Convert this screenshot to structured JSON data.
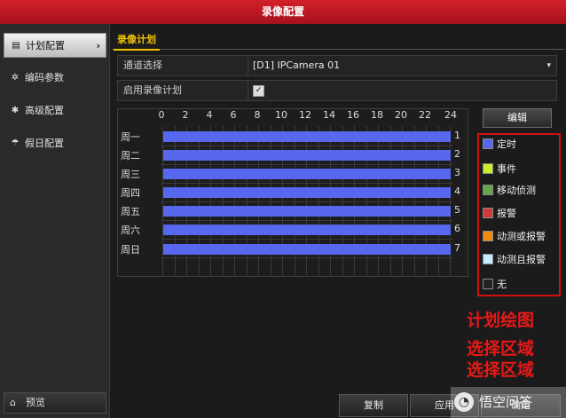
{
  "window": {
    "title": "录像配置"
  },
  "sidebar": {
    "items": [
      {
        "label": "计划配置",
        "icon": "document-icon",
        "active": true
      },
      {
        "label": "编码参数",
        "icon": "gear-icon",
        "active": false
      },
      {
        "label": "高级配置",
        "icon": "settings-icon",
        "active": false
      },
      {
        "label": "假日配置",
        "icon": "holiday-icon",
        "active": false
      }
    ],
    "preview_label": "预览"
  },
  "tabs": [
    {
      "label": "录像计划"
    }
  ],
  "form": {
    "channel_label": "通道选择",
    "channel_value": "[D1] IPCamera 01",
    "enable_label": "启用录像计划",
    "enable_checked": true
  },
  "schedule": {
    "hours": [
      "0",
      "2",
      "4",
      "6",
      "8",
      "10",
      "12",
      "14",
      "16",
      "18",
      "20",
      "22",
      "24"
    ],
    "days": [
      {
        "label": "周一",
        "num": "1",
        "type": "定时"
      },
      {
        "label": "周二",
        "num": "2",
        "type": "定时"
      },
      {
        "label": "周三",
        "num": "3",
        "type": "定时"
      },
      {
        "label": "周四",
        "num": "4",
        "type": "定时"
      },
      {
        "label": "周五",
        "num": "5",
        "type": "定时"
      },
      {
        "label": "周六",
        "num": "6",
        "type": "定时"
      },
      {
        "label": "周日",
        "num": "7",
        "type": "定时"
      }
    ]
  },
  "edit_label": "编辑",
  "legend": [
    {
      "label": "定时",
      "color": "#5768ef"
    },
    {
      "label": "事件",
      "color": "#c8f02a"
    },
    {
      "label": "移动侦测",
      "color": "#62a84a"
    },
    {
      "label": "报警",
      "color": "#d03a3a"
    },
    {
      "label": "动测或报警",
      "color": "#ef8c0e"
    },
    {
      "label": "动测且报警",
      "color": "#c8ecff"
    },
    {
      "label": "无",
      "color": "#222222"
    }
  ],
  "annotations": [
    "计划绘图",
    "选择区域",
    "选择区域"
  ],
  "buttons": {
    "copy": "复制",
    "apply": "应用",
    "ok": "确定"
  },
  "watermark": "悟空问答"
}
